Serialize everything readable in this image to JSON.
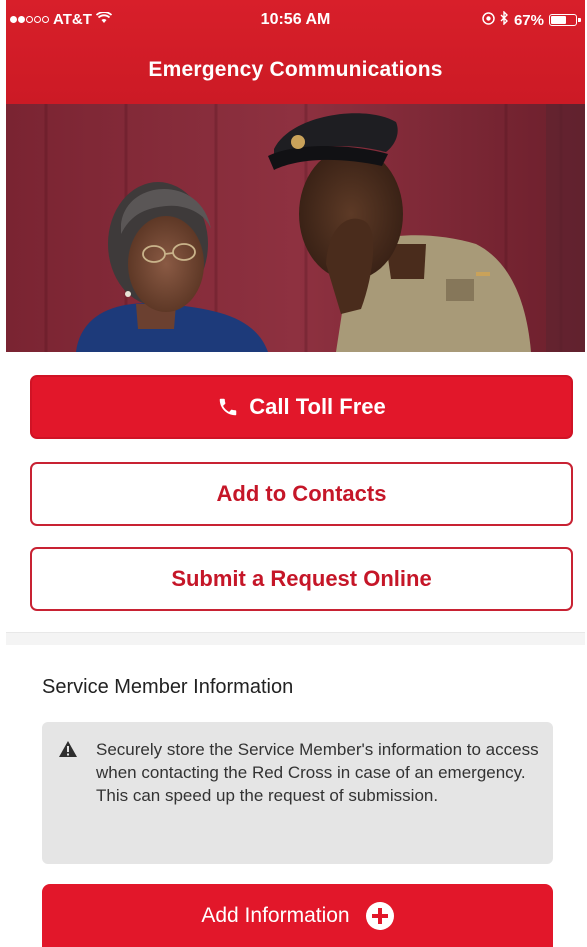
{
  "status_bar": {
    "carrier": "AT&T",
    "time": "10:56 AM",
    "battery": "67%",
    "battery_level": 0.67
  },
  "header": {
    "title": "Emergency Communications"
  },
  "actions": {
    "call_label": "Call Toll Free",
    "contacts_label": "Add to Contacts",
    "submit_label": "Submit a Request Online"
  },
  "service_member": {
    "title": "Service Member Information",
    "notice": "Securely store the Service Member's information to access when contacting the Red Cross in case of an emergency. This can speed up the request of submission.",
    "add_label": "Add Information"
  },
  "colors": {
    "brand_red": "#e2172a",
    "outline_red": "#c82233",
    "notice_bg": "#e5e5e5"
  },
  "icons": {
    "call": "phone-icon",
    "notice": "warning-icon",
    "add": "plus-circle-icon"
  }
}
